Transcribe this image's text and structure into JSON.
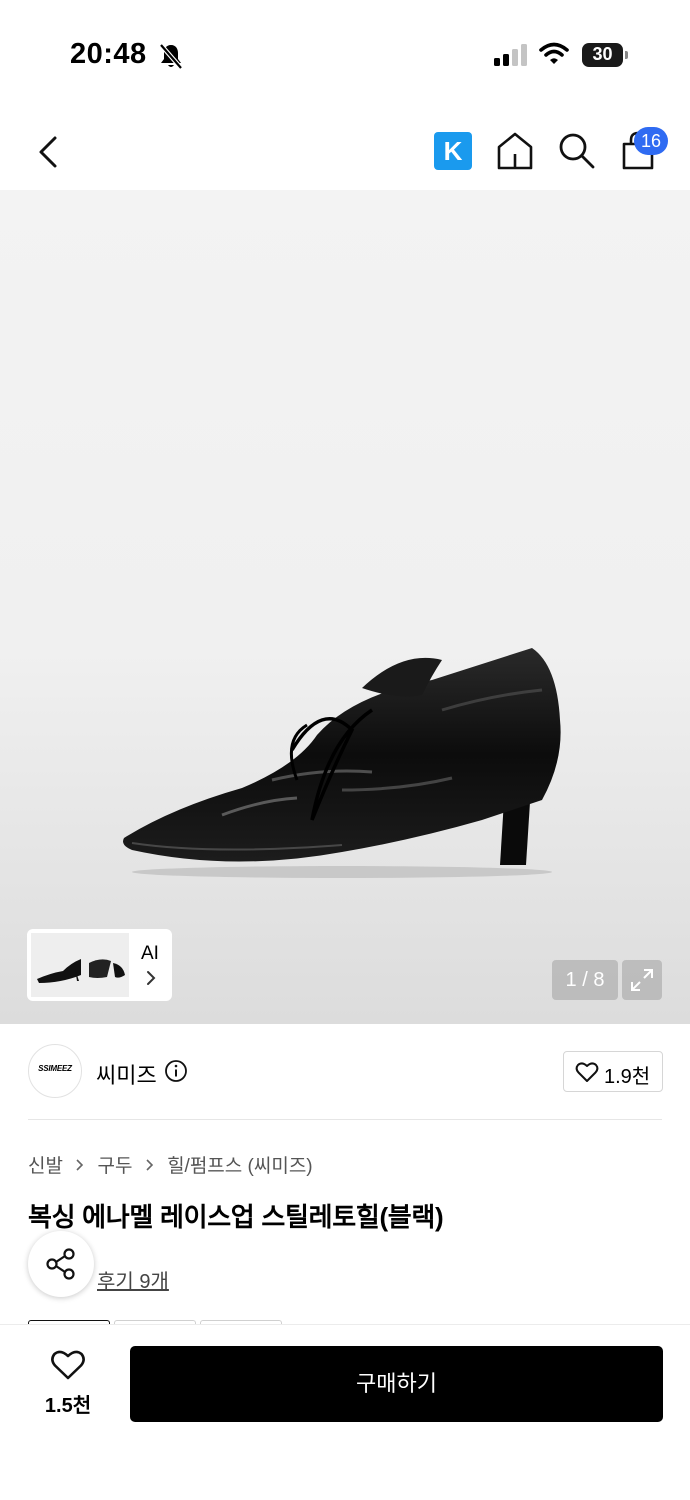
{
  "status_bar": {
    "time": "20:48",
    "battery": "30",
    "icons": [
      "bell-off-icon",
      "signal-icon",
      "wifi-icon",
      "battery-icon"
    ]
  },
  "nav": {
    "icons": [
      "back-chevron-icon",
      "k-logo-icon",
      "home-icon",
      "search-icon",
      "cart-icon"
    ],
    "k_label": "K",
    "cart_badge": "16",
    "accent_k": "#1a9aee",
    "badge_color": "#2f6bf2"
  },
  "gallery": {
    "ai_label": "AI",
    "page_indicator": "1 / 8"
  },
  "brand": {
    "logo_text": "SSIMEEZ",
    "name": "씨미즈",
    "like_count": "1.9천"
  },
  "product": {
    "breadcrumb": [
      "신발",
      "구두",
      "힐/펌프스 (씨미즈)"
    ],
    "title": "복싱 에나멜 레이스업 스틸레토힐(블랙)",
    "review_link": "후기 9개"
  },
  "bottom_bar": {
    "wish_count": "1.5천",
    "buy_label": "구매하기"
  }
}
